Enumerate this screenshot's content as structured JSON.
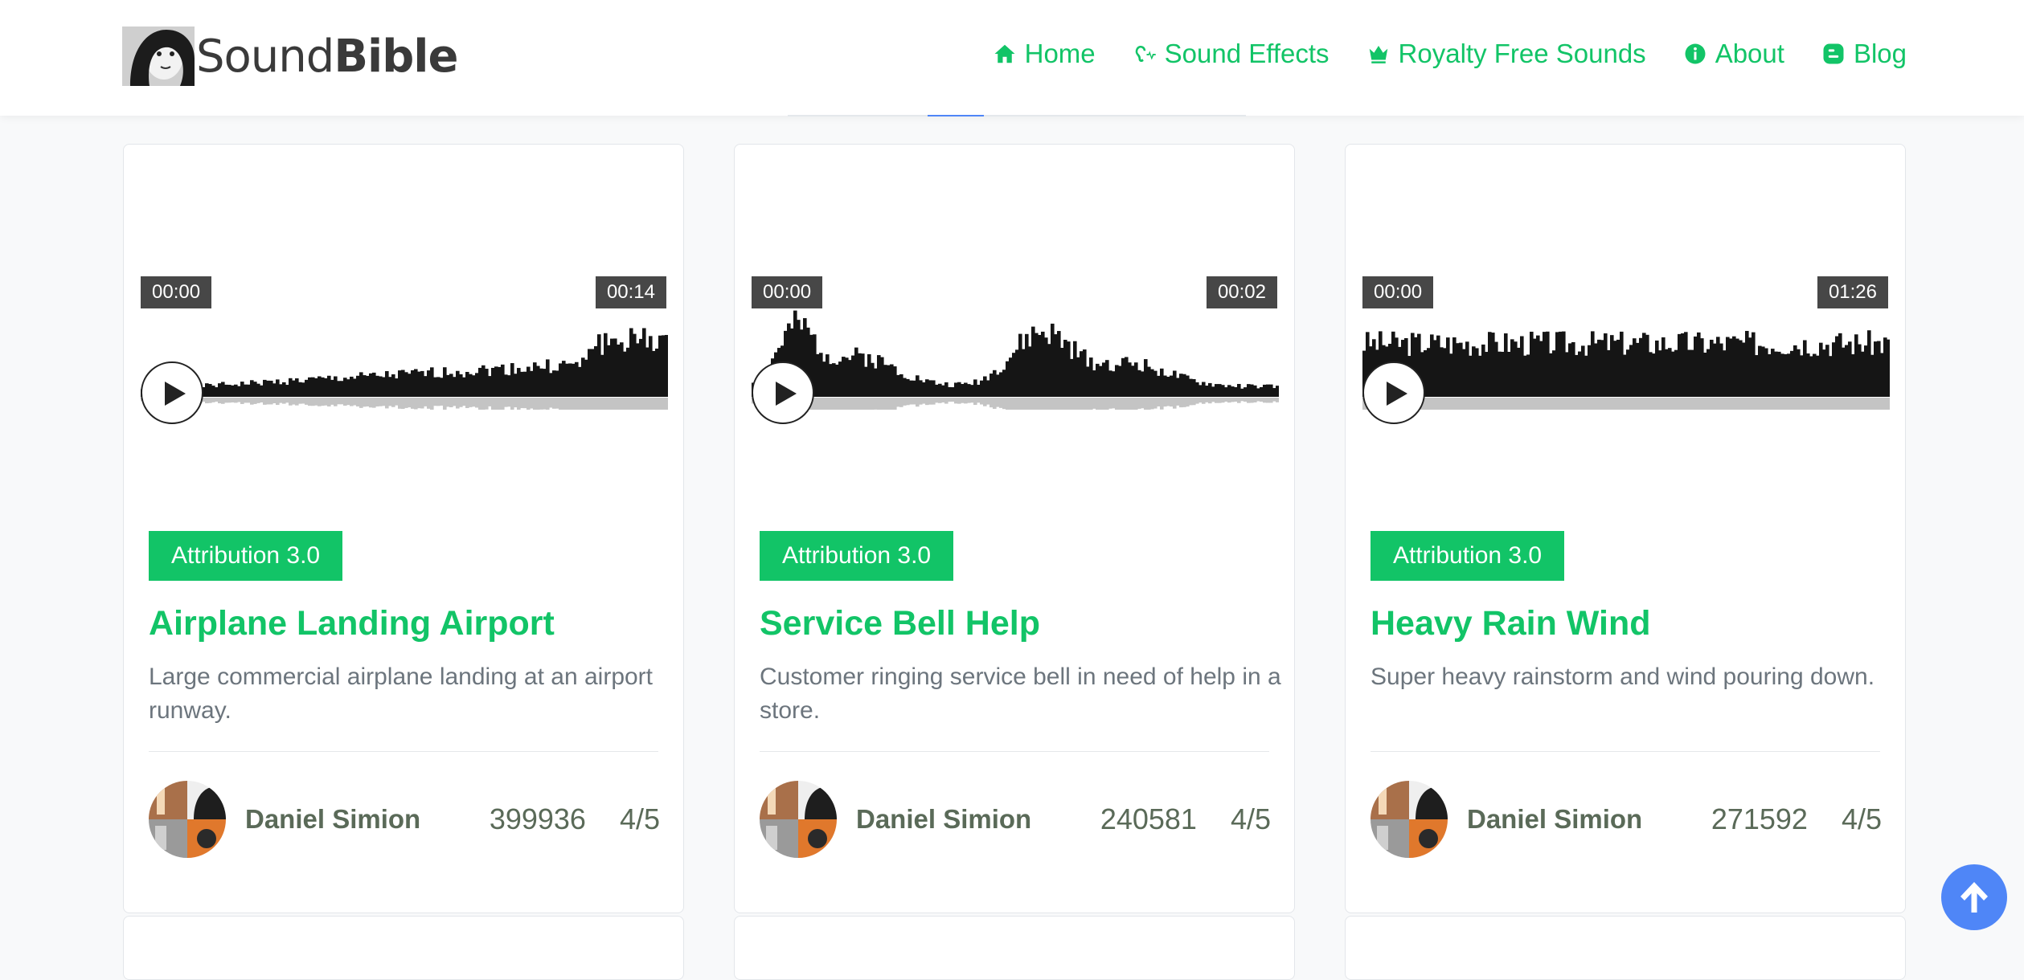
{
  "brand": {
    "name_light": "Sound",
    "name_bold": "Bible",
    "accent": "#12c467"
  },
  "nav": [
    {
      "label": "Home",
      "icon": "home-icon"
    },
    {
      "label": "Sound Effects",
      "icon": "ear-icon"
    },
    {
      "label": "Royalty Free Sounds",
      "icon": "crown-icon"
    },
    {
      "label": "About",
      "icon": "info-icon"
    },
    {
      "label": "Blog",
      "icon": "blog-icon"
    }
  ],
  "cards": [
    {
      "start": "00:00",
      "duration": "00:14",
      "license": "Attribution 3.0",
      "title": "Airplane Landing Airport",
      "description": "Large commercial airplane landing at an airport runway.",
      "author": "Daniel Simion",
      "downloads": "399936",
      "rating": "4/5"
    },
    {
      "start": "00:00",
      "duration": "00:02",
      "license": "Attribution 3.0",
      "title": "Service Bell Help",
      "description": "Customer ringing service bell in need of help in a store.",
      "author": "Daniel Simion",
      "downloads": "240581",
      "rating": "4/5"
    },
    {
      "start": "00:00",
      "duration": "01:26",
      "license": "Attribution 3.0",
      "title": "Heavy Rain Wind",
      "description": "Super heavy rainstorm and wind pouring down.",
      "author": "Daniel Simion",
      "downloads": "271592",
      "rating": "4/5"
    }
  ]
}
